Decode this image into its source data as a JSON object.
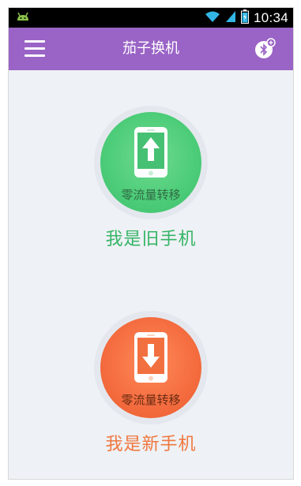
{
  "status_bar": {
    "time": "10:34",
    "icons": [
      "android-icon",
      "wifi-icon",
      "signal-icon",
      "battery-icon"
    ]
  },
  "app_bar": {
    "title": "茄子换机",
    "menu_icon": "menu-icon",
    "bluetooth_icon": "bluetooth-icon"
  },
  "old_phone": {
    "circle_label": "零流量转移",
    "title": "我是旧手机",
    "icon": "phone-upload-icon",
    "color": "#4ccc78"
  },
  "new_phone": {
    "circle_label": "零流量转移",
    "title": "我是新手机",
    "icon": "phone-download-icon",
    "color": "#f46c3f"
  },
  "colors": {
    "app_bar": "#9a63c6",
    "background": "#eef1f5"
  }
}
